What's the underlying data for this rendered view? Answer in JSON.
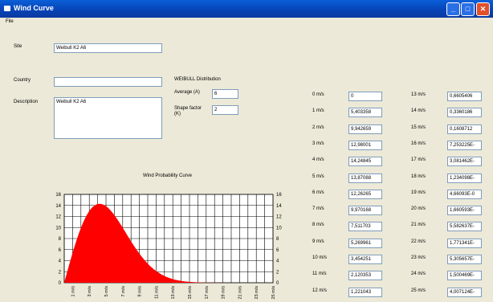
{
  "window": {
    "title": "Wind Curve"
  },
  "menu": {
    "file": "File"
  },
  "form": {
    "site_label": "Site",
    "site_value": "Weibull K2 A6",
    "country_label": "Country",
    "country_value": "",
    "description_label": "Description",
    "description_value": "Weibull K2 A6"
  },
  "weibull": {
    "heading": "WEIBULL Distribution",
    "average_label": "Average (A)",
    "average_value": "6",
    "shape_label_1": "Shape factor",
    "shape_label_2": "(K)",
    "shape_value": "2"
  },
  "speeds_left": [
    {
      "label": "0 m/s",
      "value": "0"
    },
    {
      "label": "1 m/s",
      "value": "5,403358"
    },
    {
      "label": "2 m/s",
      "value": "9,942659"
    },
    {
      "label": "3 m/s",
      "value": "12,98001"
    },
    {
      "label": "4 m/s",
      "value": "14,24845"
    },
    {
      "label": "5 m/s",
      "value": "13,87088"
    },
    {
      "label": "6 m/s",
      "value": "12,26265"
    },
    {
      "label": "7 m/s",
      "value": "9,970168"
    },
    {
      "label": "8 m/s",
      "value": "7,511703"
    },
    {
      "label": "9 m/s",
      "value": "5,269961"
    },
    {
      "label": "10 m/s",
      "value": "3,454251"
    },
    {
      "label": "11 m/s",
      "value": "2,120353"
    },
    {
      "label": "12 m/s",
      "value": "1,221043"
    }
  ],
  "speeds_right": [
    {
      "label": "13 m/s",
      "value": "0,6605406"
    },
    {
      "label": "14 m/s",
      "value": "0,3360186"
    },
    {
      "label": "15 m/s",
      "value": "0,1608712"
    },
    {
      "label": "16 m/s",
      "value": "7,253225E-"
    },
    {
      "label": "17 m/s",
      "value": "3,081462E-"
    },
    {
      "label": "18 m/s",
      "value": "1,234098E-"
    },
    {
      "label": "19 m/s",
      "value": "4,66093E-0"
    },
    {
      "label": "20 m/s",
      "value": "1,660593E-"
    },
    {
      "label": "21 m/s",
      "value": "5,582637E-"
    },
    {
      "label": "22 m/s",
      "value": "1,771341E-"
    },
    {
      "label": "23 m/s",
      "value": "5,305657E-"
    },
    {
      "label": "24 m/s",
      "value": "1,500469E-"
    },
    {
      "label": "25 m/s",
      "value": "4,007124E-"
    }
  ],
  "chart_data": {
    "type": "area",
    "title": "Wind Probability Curve",
    "x": [
      "1 m/s",
      "3 m/s",
      "5 m/s",
      "7 m/s",
      "9 m/s",
      "11 m/s",
      "13 m/s",
      "15 m/s",
      "17 m/s",
      "19 m/s",
      "21 m/s",
      "23 m/s",
      "25 m/s"
    ],
    "x_numeric": [
      0,
      1,
      2,
      3,
      4,
      5,
      6,
      7,
      8,
      9,
      10,
      11,
      12,
      13,
      14,
      15,
      16,
      17,
      18,
      19,
      20,
      21,
      22,
      23,
      24,
      25
    ],
    "values": [
      0,
      5.403,
      9.943,
      12.98,
      14.248,
      13.871,
      12.263,
      9.97,
      7.512,
      5.27,
      3.454,
      2.12,
      1.221,
      0.661,
      0.336,
      0.161,
      0.073,
      0.031,
      0.012,
      0.005,
      0.002,
      0.001,
      0,
      0,
      0,
      0
    ],
    "y_ticks": [
      0,
      2,
      4,
      6,
      8,
      10,
      12,
      14,
      16
    ],
    "ylim": [
      0,
      16
    ],
    "fill_color": "#ff0000",
    "grid": true
  }
}
